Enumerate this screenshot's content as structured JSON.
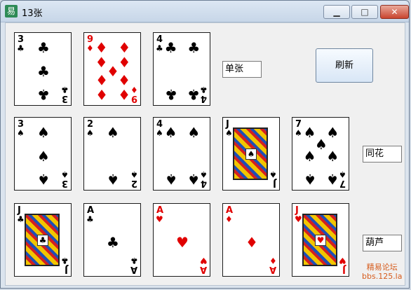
{
  "window": {
    "icon_text": "易",
    "title": "13张",
    "min_glyph": "▁",
    "max_glyph": "□",
    "close_glyph": "✕"
  },
  "row1": {
    "cards": [
      {
        "rank": "3",
        "suit": "♣",
        "color": "black",
        "pips": [
          [
            50,
            20
          ],
          [
            50,
            52
          ],
          [
            50,
            84
          ]
        ]
      },
      {
        "rank": "9",
        "suit": "♦",
        "color": "red",
        "pips": [
          [
            30,
            20
          ],
          [
            70,
            20
          ],
          [
            30,
            40
          ],
          [
            70,
            40
          ],
          [
            50,
            52
          ],
          [
            30,
            64
          ],
          [
            70,
            64
          ],
          [
            30,
            84
          ],
          [
            70,
            84
          ]
        ]
      },
      {
        "rank": "4",
        "suit": "♣",
        "color": "black",
        "pips": [
          [
            30,
            20
          ],
          [
            70,
            20
          ],
          [
            30,
            84
          ],
          [
            70,
            84
          ]
        ]
      }
    ],
    "label": "单张"
  },
  "row2": {
    "cards": [
      {
        "rank": "3",
        "suit": "♠",
        "color": "black",
        "pips": [
          [
            50,
            20
          ],
          [
            50,
            52
          ],
          [
            50,
            84
          ]
        ]
      },
      {
        "rank": "2",
        "suit": "♠",
        "color": "black",
        "pips": [
          [
            50,
            20
          ],
          [
            50,
            84
          ]
        ]
      },
      {
        "rank": "4",
        "suit": "♠",
        "color": "black",
        "pips": [
          [
            30,
            20
          ],
          [
            70,
            20
          ],
          [
            30,
            84
          ],
          [
            70,
            84
          ]
        ]
      },
      {
        "rank": "J",
        "suit": "♠",
        "color": "black",
        "face": true
      },
      {
        "rank": "7",
        "suit": "♠",
        "color": "black",
        "pips": [
          [
            30,
            20
          ],
          [
            70,
            20
          ],
          [
            50,
            36
          ],
          [
            30,
            52
          ],
          [
            70,
            52
          ],
          [
            30,
            84
          ],
          [
            70,
            84
          ]
        ]
      }
    ],
    "label": "同花"
  },
  "row3": {
    "cards": [
      {
        "rank": "J",
        "suit": "♣",
        "color": "black",
        "face": true
      },
      {
        "rank": "A",
        "suit": "♣",
        "color": "black",
        "pips": [
          [
            50,
            52
          ]
        ]
      },
      {
        "rank": "A",
        "suit": "♥",
        "color": "red",
        "pips": [
          [
            50,
            52
          ]
        ]
      },
      {
        "rank": "A",
        "suit": "♦",
        "color": "red",
        "pips": [
          [
            50,
            52
          ]
        ]
      },
      {
        "rank": "J",
        "suit": "♥",
        "color": "red",
        "face": true
      }
    ],
    "label": "葫芦"
  },
  "buttons": {
    "refresh": "刷新"
  },
  "watermark": {
    "line1": "精易论坛",
    "line2": "bbs.125.la"
  }
}
